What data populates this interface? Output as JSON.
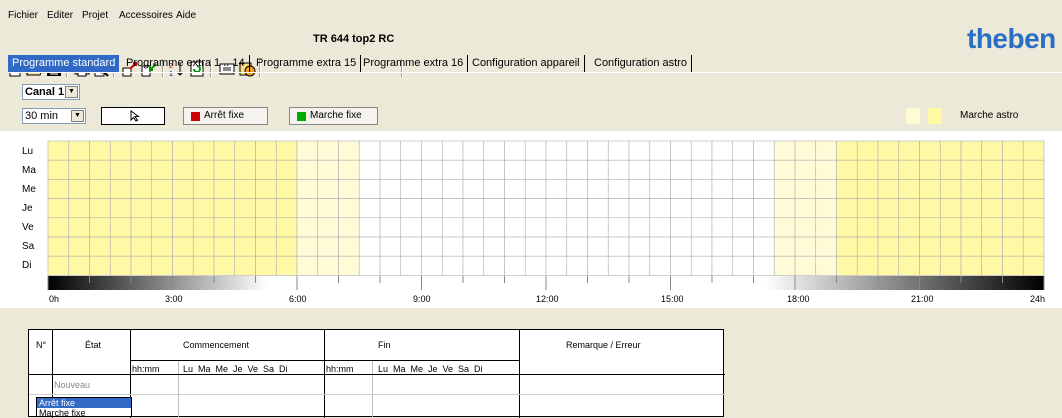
{
  "menu": [
    "Fichier",
    "Editer",
    "Projet",
    "Accessoires",
    "Aide"
  ],
  "toolbar": {
    "device_name": "TR 644 top2 RC",
    "icons": [
      "new-file-icon",
      "open-folder-icon",
      "save-icon",
      "print-icon",
      "print-preview-icon",
      "upload-icon",
      "download-icon",
      "sort-icon",
      "refresh-icon",
      "display-icon",
      "clock-icon"
    ]
  },
  "logo": "theben",
  "tabs": [
    "Programme standard",
    "Programme extra 1 .. 14",
    "Programme extra 15",
    "Programme extra 16",
    "Configuration appareil",
    "Configuration astro"
  ],
  "active_tab": 0,
  "canal": {
    "value": "Canal 1"
  },
  "interval": {
    "value": "30 min"
  },
  "buttons": {
    "stop": "Arrêt fixe",
    "start": "Marche fixe"
  },
  "legend": {
    "label": "Marche astro"
  },
  "colors": {
    "accent": "#3169c6",
    "stop": "#cc0000",
    "start": "#00aa00",
    "astro_light": "#fffbd6",
    "astro": "#fff9a6"
  },
  "days": [
    "Lu",
    "Ma",
    "Me",
    "Je",
    "Ve",
    "Sa",
    "Di"
  ],
  "hours": [
    "0h",
    "3:00",
    "6:00",
    "9:00",
    "12:00",
    "15:00",
    "18:00",
    "21:00",
    "24h"
  ],
  "astro_schedule": {
    "slot_minutes": 30,
    "marche_astro_until": "06:00",
    "marche_astro_light_until": "07:30",
    "marche_astro_light_from": "17:30",
    "marche_astro_from": "19:00"
  },
  "table": {
    "headers": {
      "no": "N°",
      "etat": "État",
      "commencement": "Commencement",
      "fin": "Fin",
      "remarque": "Remarque / Erreur"
    },
    "sub": {
      "hhmm": "hh:mm",
      "days": "Lu  Ma  Me  Je  Ve  Sa  Di"
    },
    "new_row": "Nouveau",
    "dropdown": [
      "Arrêt fixe",
      "Marche fixe"
    ]
  }
}
